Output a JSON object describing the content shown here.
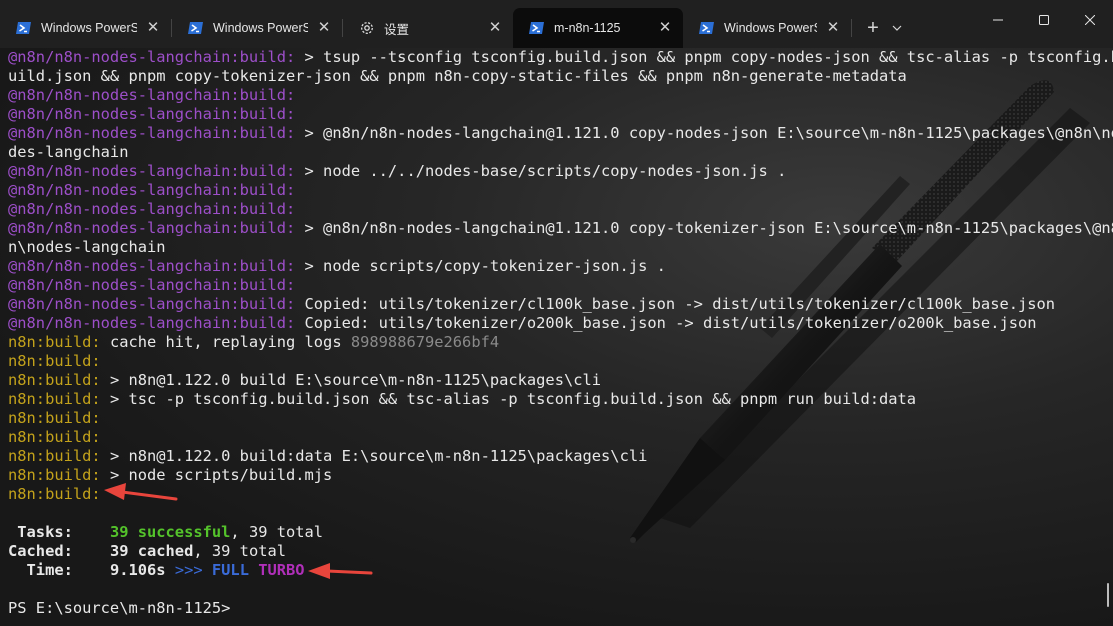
{
  "tabs": [
    {
      "title": "Windows PowerSh",
      "icon": "powershell-icon",
      "active": false
    },
    {
      "title": "Windows PowerSh",
      "icon": "powershell-icon",
      "active": false
    },
    {
      "title": "设置",
      "icon": "gear-icon",
      "active": false
    },
    {
      "title": "m-n8n-1125",
      "icon": "powershell-icon",
      "active": true
    },
    {
      "title": "Windows PowerSh",
      "icon": "powershell-icon",
      "active": false
    }
  ],
  "tab_close_glyph": "✕",
  "new_tab_glyph": "+",
  "dropdown_glyph": "⌄",
  "window_controls": [
    "minimize",
    "maximize",
    "close"
  ],
  "colors": {
    "terminal_bg": "#1b1b1b",
    "prefix_purple": "#9d4fc9",
    "prefix_yellow": "#c3a21b",
    "success_green": "#54c32b",
    "turbo_blue": "#3a6bd8",
    "turbo_magenta": "#b02fb9",
    "annotation_red": "#e8453c"
  },
  "terminal": {
    "lines": [
      [
        {
          "t": "@n8n/n8n-nodes-langchain:build:",
          "c": "purple"
        },
        {
          "t": " > tsup --tsconfig tsconfig.build.json && pnpm copy-nodes-json && tsc-alias -p tsconfig.b",
          "c": "white"
        }
      ],
      [
        {
          "t": "uild.json && pnpm copy-tokenizer-json && pnpm n8n-copy-static-files && pnpm n8n-generate-metadata",
          "c": "white"
        }
      ],
      [
        {
          "t": "@n8n/n8n-nodes-langchain:build:",
          "c": "purple"
        }
      ],
      [
        {
          "t": "@n8n/n8n-nodes-langchain:build:",
          "c": "purple"
        }
      ],
      [
        {
          "t": "@n8n/n8n-nodes-langchain:build:",
          "c": "purple"
        },
        {
          "t": " > @n8n/n8n-nodes-langchain@1.121.0 copy-nodes-json E:\\source\\m-n8n-1125\\packages\\@n8n\\no",
          "c": "white"
        }
      ],
      [
        {
          "t": "des-langchain",
          "c": "white"
        }
      ],
      [
        {
          "t": "@n8n/n8n-nodes-langchain:build:",
          "c": "purple"
        },
        {
          "t": " > node ../../nodes-base/scripts/copy-nodes-json.js .",
          "c": "white"
        }
      ],
      [
        {
          "t": "@n8n/n8n-nodes-langchain:build:",
          "c": "purple"
        }
      ],
      [
        {
          "t": "@n8n/n8n-nodes-langchain:build:",
          "c": "purple"
        }
      ],
      [
        {
          "t": "@n8n/n8n-nodes-langchain:build:",
          "c": "purple"
        },
        {
          "t": " > @n8n/n8n-nodes-langchain@1.121.0 copy-tokenizer-json E:\\source\\m-n8n-1125\\packages\\@n8",
          "c": "white"
        }
      ],
      [
        {
          "t": "n\\nodes-langchain",
          "c": "white"
        }
      ],
      [
        {
          "t": "@n8n/n8n-nodes-langchain:build:",
          "c": "purple"
        },
        {
          "t": " > node scripts/copy-tokenizer-json.js .",
          "c": "white"
        }
      ],
      [
        {
          "t": "@n8n/n8n-nodes-langchain:build:",
          "c": "purple"
        }
      ],
      [
        {
          "t": "@n8n/n8n-nodes-langchain:build:",
          "c": "purple"
        },
        {
          "t": " Copied: utils/tokenizer/cl100k_base.json -> dist/utils/tokenizer/cl100k_base.json",
          "c": "white"
        }
      ],
      [
        {
          "t": "@n8n/n8n-nodes-langchain:build:",
          "c": "purple"
        },
        {
          "t": " Copied: utils/tokenizer/o200k_base.json -> dist/utils/tokenizer/o200k_base.json",
          "c": "white"
        }
      ],
      [
        {
          "t": "n8n:build:",
          "c": "yellow"
        },
        {
          "t": " cache hit, replaying logs ",
          "c": "white"
        },
        {
          "t": "898988679e266bf4",
          "c": "gray"
        }
      ],
      [
        {
          "t": "n8n:build:",
          "c": "yellow"
        }
      ],
      [
        {
          "t": "n8n:build:",
          "c": "yellow"
        },
        {
          "t": " > n8n@1.122.0 build E:\\source\\m-n8n-1125\\packages\\cli",
          "c": "white"
        }
      ],
      [
        {
          "t": "n8n:build:",
          "c": "yellow"
        },
        {
          "t": " > tsc -p tsconfig.build.json && tsc-alias -p tsconfig.build.json && pnpm run build:data",
          "c": "white"
        }
      ],
      [
        {
          "t": "n8n:build:",
          "c": "yellow"
        }
      ],
      [
        {
          "t": "n8n:build:",
          "c": "yellow"
        }
      ],
      [
        {
          "t": "n8n:build:",
          "c": "yellow"
        },
        {
          "t": " > n8n@1.122.0 build:data E:\\source\\m-n8n-1125\\packages\\cli",
          "c": "white"
        }
      ],
      [
        {
          "t": "n8n:build:",
          "c": "yellow"
        },
        {
          "t": " > node scripts/build.mjs",
          "c": "white"
        }
      ],
      [
        {
          "t": "n8n:build:",
          "c": "yellow"
        }
      ],
      [],
      [
        {
          "t": " Tasks:    ",
          "c": "white bold"
        },
        {
          "t": "39 successful",
          "c": "green bold"
        },
        {
          "t": ", 39 total",
          "c": "white"
        }
      ],
      [
        {
          "t": "Cached:    ",
          "c": "white bold"
        },
        {
          "t": "39 cached",
          "c": "white bold"
        },
        {
          "t": ", 39 total",
          "c": "white"
        }
      ],
      [
        {
          "t": "  Time:    ",
          "c": "white bold"
        },
        {
          "t": "9.106s ",
          "c": "white bold"
        },
        {
          "t": ">>> ",
          "c": "blue"
        },
        {
          "t": "FULL ",
          "c": "blue bold"
        },
        {
          "t": "TURBO",
          "c": "magenta bold"
        }
      ],
      [],
      [
        {
          "t": "PS E:\\source\\m-n8n-1125>",
          "c": "white"
        }
      ]
    ]
  }
}
